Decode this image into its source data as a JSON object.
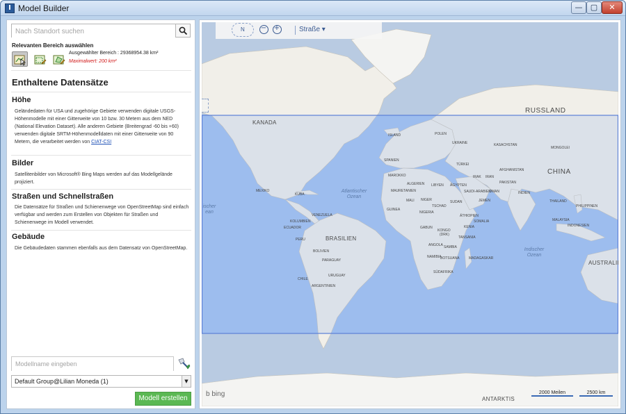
{
  "window": {
    "title": "Model Builder",
    "minimize": "—",
    "maximize": "▢",
    "close": "✕"
  },
  "search": {
    "placeholder": "Nach Standort suchen"
  },
  "region": {
    "title": "Relevanten Bereich auswählen",
    "tools": [
      "select-area-icon",
      "draw-area-icon",
      "edit-area-icon"
    ],
    "selected_area": "Ausgewählter Bereich : 29368954.38 km²",
    "max_value": "Maximalwert: 200 km²"
  },
  "datasets": {
    "heading": "Enthaltene Datensätze",
    "sections": [
      {
        "title": "Höhe",
        "text": "Geländedaten für USA und zugehörige Gebiete verwenden digitale USGS-Höhenmodelle mit einer Gitterweite von 10 bzw. 30 Metern aus dem NED (National Elevation Dataset). Alle anderen Gebiete (Breitengrad -60 bis +60) verwenden digitale SRTM-Höhenmodelldaten mit einer Gitterweite von 90 Metern, die verarbeitet werden von",
        "link": "CIAT-CSI"
      },
      {
        "title": "Bilder",
        "text": "Satellitenbilder von Microsoft® Bing Maps werden auf das Modellgelände projiziert."
      },
      {
        "title": "Straßen und Schnellstraßen",
        "text": "Die Datensätze für Straßen und Schienenwege von OpenStreetMap sind einfach verfügbar und werden zum Erstellen von Objekten für Straßen und Schienenwege im Modell verwendet."
      },
      {
        "title": "Gebäude",
        "text": "Die Gebäudedaten stammen ebenfalls aus dem Datensatz von OpenStreetMap."
      }
    ]
  },
  "model": {
    "name_placeholder": "Modellname eingeben",
    "group": "Default Group@Lilian Moneda (1)",
    "create_label": "Modell erstellen"
  },
  "map": {
    "compass": "N",
    "zoom_out": "−",
    "zoom_in": "+",
    "style": "Straße ▾",
    "bing": "bing",
    "scale_miles": "2000 Meilen",
    "scale_km": "2500 km",
    "labels": {
      "russland": "RUSSLAND",
      "kanada": "KANADA",
      "china": "CHINA",
      "brasilien": "BRASILIEN",
      "australie": "AUSTRALIE",
      "antarktis": "ANTARKTIS",
      "mexiko": "MEXIKO",
      "atlantic": "Atlantischer Ozean",
      "indic": "Indischer Ozean",
      "pacific": "ischer ean",
      "island": "ISLAND",
      "polen": "POLEN",
      "ukraine": "UKRAINE",
      "kasachstan": "KASACHSTAN",
      "mongolei": "MONGOLEI",
      "turkei": "TÜRKEI",
      "irak": "IRAK",
      "iran": "IRAN",
      "afghanistan": "AFGHANISTAN",
      "pakistan": "PAKISTAN",
      "indien": "INDIEN",
      "thailand": "THAILAND",
      "philippinen": "PHILIPPINEN",
      "malaysia": "MALAYSIA",
      "indonesien": "INDONESIEN",
      "spanien": "SPANIEN",
      "marokko": "MAROKKO",
      "algerien": "ALGERIEN",
      "libyen": "LIBYEN",
      "agypten": "ÄGYPTEN",
      "saudi": "SAUDI-ARABIEN",
      "oman": "OMAN",
      "jemen": "JEMEN",
      "mali": "MALI",
      "niger": "NIGER",
      "tschad": "TSCHAD",
      "sudan": "SUDAN",
      "mauretanien": "MAURETANIEN",
      "guinea": "GUINEA",
      "nigeria": "NIGERIA",
      "athiopien": "ÄTHIOPIEN",
      "somalia": "SOMALIA",
      "kenia": "KENIA",
      "gabun": "GABUN",
      "kongo": "KONGO",
      "drk": "(DRK)",
      "tansania": "TANSANIA",
      "angola": "ANGOLA",
      "sambia": "SAMBIA",
      "namibia": "NAMIBIA",
      "botsuana": "BOTSUANA",
      "sudafrika": "SÜDAFRIKA",
      "madagaskar": "MADAGASKAR",
      "kuba": "KUBA",
      "venezuela": "VENEZUELA",
      "kolumbien": "KOLUMBIEN",
      "ecuador": "ECUADOR",
      "peru": "PERU",
      "bolivien": "BOLIVIEN",
      "paraguay": "PARAGUAY",
      "chile": "CHILE",
      "uruguay": "URUGUAY",
      "argentinien": "ARGENTINIEN"
    }
  }
}
